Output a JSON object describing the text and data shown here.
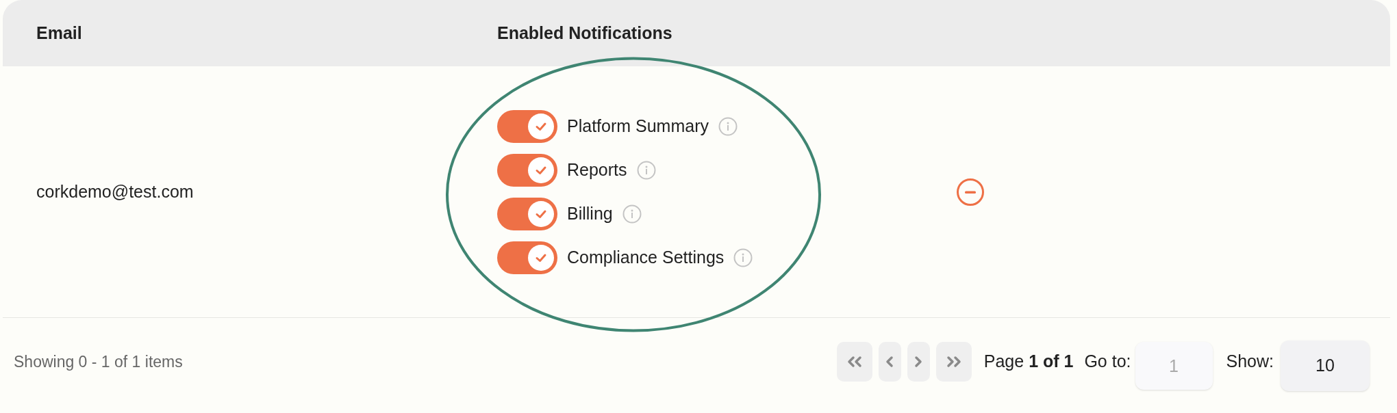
{
  "table": {
    "columns": [
      "Email",
      "Enabled Notifications"
    ],
    "rows": [
      {
        "email": "corkdemo@test.com",
        "notifications": [
          {
            "label": "Platform Summary",
            "on": true
          },
          {
            "label": "Reports",
            "on": true
          },
          {
            "label": "Billing",
            "on": true
          },
          {
            "label": "Compliance Settings",
            "on": true
          }
        ]
      }
    ]
  },
  "footer": {
    "summary": "Showing 0 - 1 of 1 items",
    "page_info": "Page **1 of 1**",
    "goto_label": "Go to:",
    "goto_placeholder": "1",
    "show_label": "Show:",
    "show_value": "10"
  }
}
